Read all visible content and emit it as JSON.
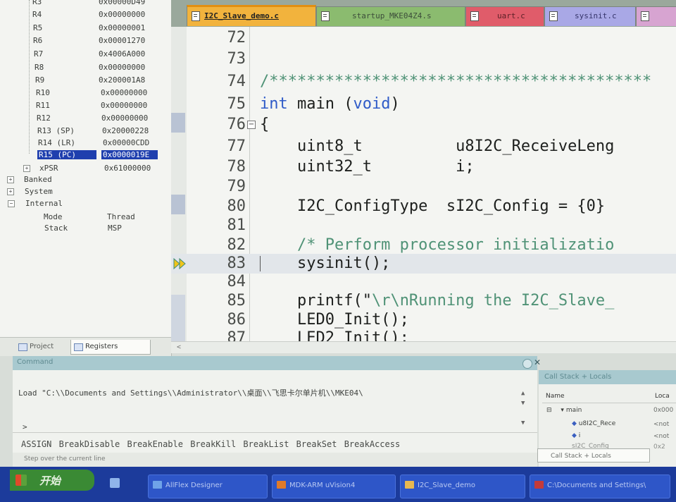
{
  "registers": {
    "rows": [
      {
        "name": "R3",
        "value": "0x00000D49"
      },
      {
        "name": "R4",
        "value": "0x00000000"
      },
      {
        "name": "R5",
        "value": "0x00000001"
      },
      {
        "name": "R6",
        "value": "0x00001270"
      },
      {
        "name": "R7",
        "value": "0x4006A000"
      },
      {
        "name": "R8",
        "value": "0x00000000"
      },
      {
        "name": "R9",
        "value": "0x200001A8"
      },
      {
        "name": "R10",
        "value": "0x00000000"
      },
      {
        "name": "R11",
        "value": "0x00000000"
      },
      {
        "name": "R12",
        "value": "0x00000000"
      },
      {
        "name": "R13 (SP)",
        "value": "0x20000228"
      },
      {
        "name": "R14 (LR)",
        "value": "0x00000CDD"
      },
      {
        "name": "R15 (PC)",
        "value": "0x0000019E"
      },
      {
        "name": "xPSR",
        "value": "0x61000000"
      }
    ],
    "groups": [
      "Banked",
      "System",
      "Internal"
    ],
    "internal": [
      {
        "name": "Mode",
        "value": "Thread"
      },
      {
        "name": "Stack",
        "value": "MSP"
      }
    ],
    "tabs": [
      "Project",
      "Registers"
    ]
  },
  "editor": {
    "tabs": [
      "I2C_Slave_demo.c",
      "startup_MKE04Z4.s",
      "uart.c",
      "sysinit.c",
      ""
    ],
    "lines": [
      {
        "num": "72",
        "text": ""
      },
      {
        "num": "73",
        "text": ""
      },
      {
        "num": "74",
        "text": "/*****************************************"
      },
      {
        "num": "75",
        "kw": "int",
        "text": " main (",
        "kw2": "void",
        "text2": ")"
      },
      {
        "num": "76",
        "text": "{"
      },
      {
        "num": "77",
        "text": "    uint8_t          u8I2C_ReceiveLeng"
      },
      {
        "num": "78",
        "text": "    uint32_t         i;"
      },
      {
        "num": "79",
        "text": ""
      },
      {
        "num": "80",
        "text": "    I2C_ConfigType  sI2C_Config = {0}"
      },
      {
        "num": "81",
        "text": ""
      },
      {
        "num": "82",
        "comment": "    /* Perform processor initializatio"
      },
      {
        "num": "83",
        "text": "    sysinit();"
      },
      {
        "num": "84",
        "text": ""
      },
      {
        "num": "85",
        "text": "    printf(\"",
        "str": "\\r\\nRunning the I2C_Slave_"
      },
      {
        "num": "86",
        "text": "    LED0_Init();"
      },
      {
        "num": "87",
        "text": "    LED2_Init();"
      }
    ]
  },
  "command": {
    "title": "Command",
    "output": "Load \"C:\\\\Documents and Settings\\\\Administrator\\\\桌面\\\\飞思卡尔单片机\\\\MKE04\\",
    "prompt": ">",
    "keywords": "ASSIGN BreakDisable BreakEnable BreakKill BreakList BreakSet BreakAccess",
    "status": "Step over the current line"
  },
  "callstack": {
    "title": "Call Stack + Locals",
    "col_name": "Name",
    "col_location": "Loca",
    "rows": [
      {
        "name": "main",
        "value": "0x000"
      },
      {
        "name": "u8I2C_Rece",
        "value": "<not"
      },
      {
        "name": "i",
        "value": "<not"
      },
      {
        "name": "sI2C_Config",
        "value": "0x2"
      }
    ],
    "tab": "Call Stack + Locals"
  },
  "taskbar": {
    "start": "开始",
    "tasks": [
      "AllFlex Designer",
      "MDK-ARM  uVision4",
      "I2C_Slave_demo",
      "C:\\Documents and Settings\\"
    ]
  },
  "colors": {
    "accent_tab": "#f2b33d",
    "selected_register": "#1f3fae",
    "taskbar": "#1c3b9b"
  }
}
